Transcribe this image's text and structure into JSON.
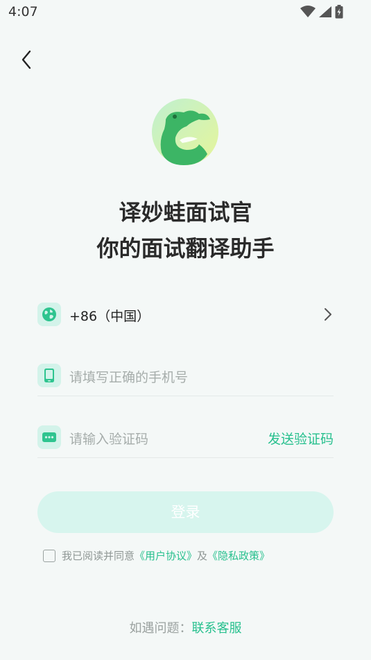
{
  "status_bar": {
    "time": "4:07"
  },
  "header": {
    "back_icon": "chevron-left-icon"
  },
  "brand": {
    "title": "译妙蛙面试官",
    "subtitle": "你的面试翻译助手"
  },
  "form": {
    "country": {
      "icon": "globe-icon",
      "value": "+86（中国）",
      "chevron": "chevron-right-icon"
    },
    "phone": {
      "icon": "phone-icon",
      "placeholder": "请填写正确的手机号"
    },
    "code": {
      "icon": "message-icon",
      "placeholder": "请输入验证码",
      "send_label": "发送验证码"
    },
    "login_label": "登录"
  },
  "agreement": {
    "prefix": "我已阅读并同意",
    "user_agreement": "《用户协议》",
    "and": "及",
    "privacy_policy": "《隐私政策》",
    "checked": false
  },
  "help": {
    "prefix": "如遇问题：",
    "contact": "联系客服"
  },
  "colors": {
    "accent": "#27c08e",
    "icon_bg": "#d3f3ea",
    "button_disabled": "#d7f5ee",
    "background": "#f4f8f7"
  }
}
